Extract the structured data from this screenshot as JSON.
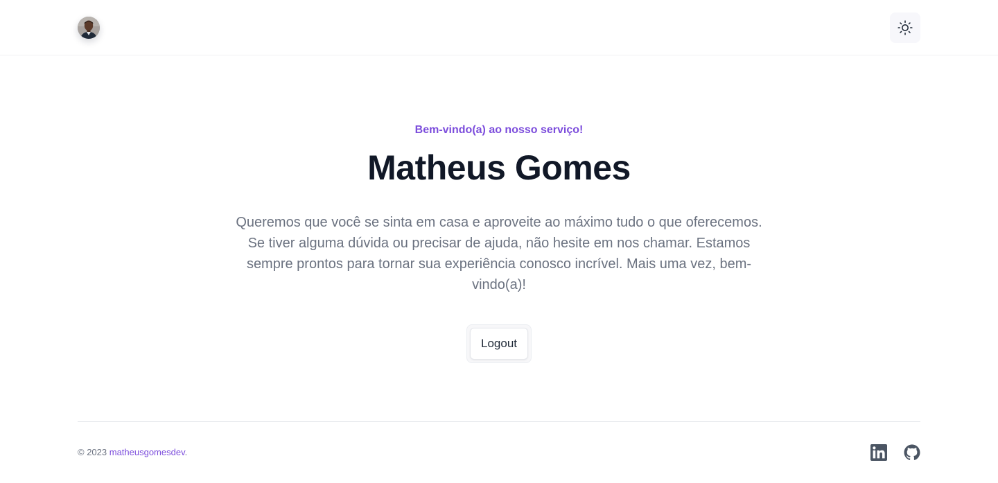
{
  "header": {
    "avatar_alt": "avatar",
    "theme_toggle_icon": "sun-icon"
  },
  "hero": {
    "eyebrow": "Bem-vindo(a) ao nosso serviço!",
    "title": "Matheus Gomes",
    "description": "Queremos que você se sinta em casa e aproveite ao máximo tudo o que oferecemos. Se tiver alguma dúvida ou precisar de ajuda, não hesite em nos chamar. Estamos sempre prontos para tornar sua experiência conosco incrível. Mais uma vez, bem-vindo(a)!",
    "logout_label": "Logout"
  },
  "footer": {
    "copyright_prefix": "© 2023 ",
    "copyright_link": "matheusgomesdev",
    "copyright_suffix": ".",
    "social_icons": [
      "linkedin-icon",
      "github-icon"
    ]
  },
  "colors": {
    "accent": "#7c4ddc",
    "heading": "#111827",
    "body_text": "#6b7280",
    "divider": "#e5e7eb",
    "icon": "#4b5563"
  }
}
